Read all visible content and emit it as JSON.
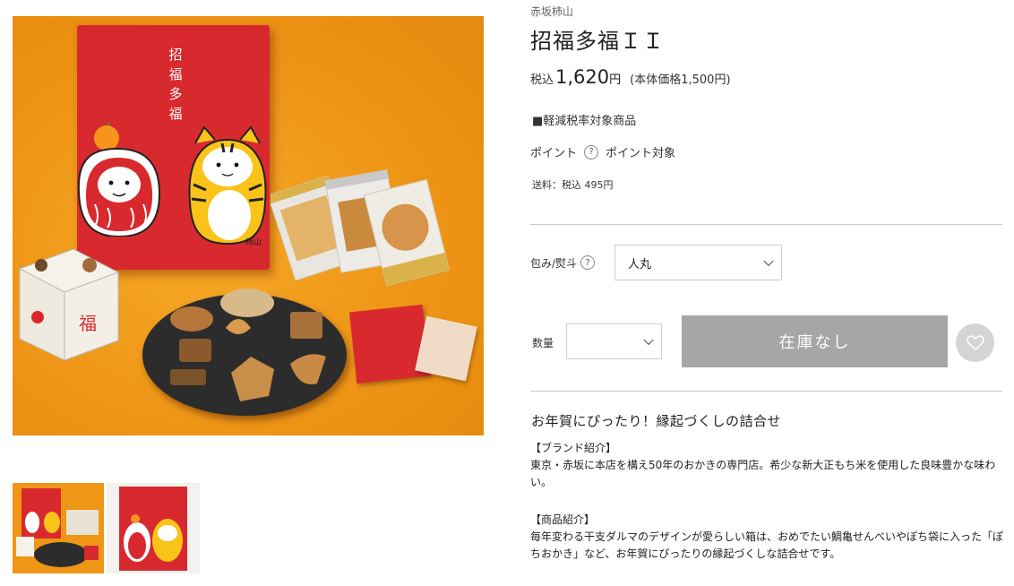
{
  "product": {
    "brand": "赤坂柿山",
    "title": "招福多福ＩＩ",
    "price_prefix": "税込",
    "price_value": "1,620",
    "price_unit": "円",
    "price_note": "(本体価格1,500円)",
    "tax_note": "■軽減税率対象商品",
    "point_label": "ポイント",
    "point_value": "ポイント対象",
    "shipping": "送料：税込 495円"
  },
  "package_art": {
    "box_title": "招福多福",
    "box_logo": "柿山"
  },
  "options": {
    "wrapping_label": "包み/熨斗",
    "wrapping_value": "人丸",
    "quantity_label": "数量",
    "quantity_value": ""
  },
  "buttons": {
    "sold_out": "在庫なし"
  },
  "description": {
    "heading": "お年賀にぴったり！縁起づくしの詰合せ",
    "brand_heading": "【ブランド紹介】",
    "brand_text": "東京・赤坂に本店を構え50年のおかきの専門店。希少な新大正もち米を使用した良味豊かな味わい。",
    "product_heading": "【商品紹介】",
    "product_text": "毎年変わる干支ダルマのデザインが愛らしい箱は、おめでたい鯛亀せんべいやぽち袋に入った「ぽちおかき」など、お年賀にぴったりの縁起づくしな詰合せです。"
  },
  "colors": {
    "box_red": "#d82a2e",
    "background_orange": "#f19a17",
    "sold_out_gray": "#a6a6a6"
  }
}
